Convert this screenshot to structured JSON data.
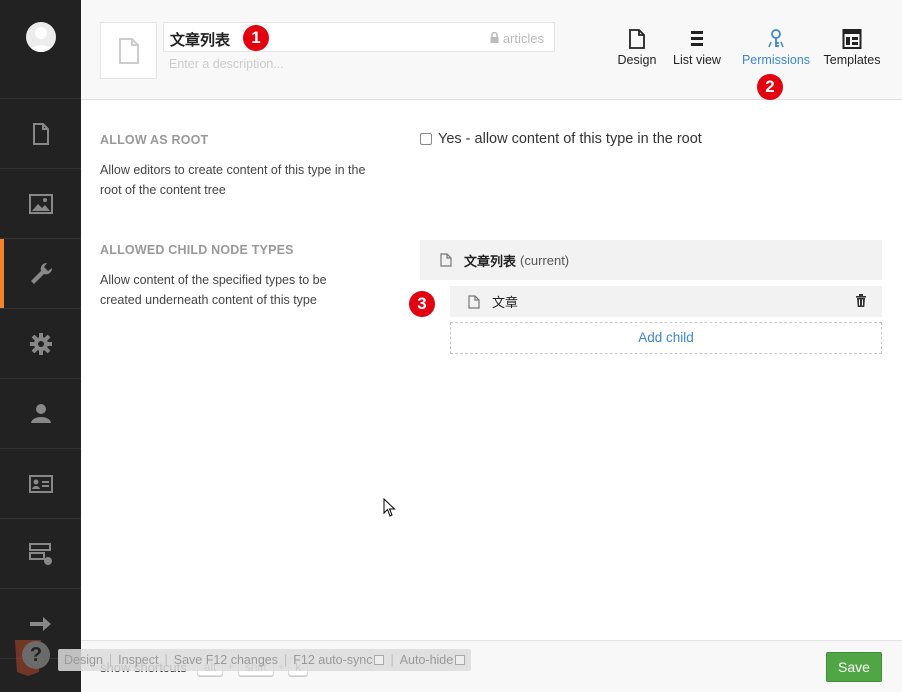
{
  "header": {
    "name_value": "文章列表",
    "alias": "articles",
    "description_placeholder": "Enter a description...",
    "tabs": [
      {
        "label": "Design",
        "icon": "document-icon"
      },
      {
        "label": "List view",
        "icon": "list-icon"
      },
      {
        "label": "Permissions",
        "icon": "key-icon",
        "active": true
      },
      {
        "label": "Templates",
        "icon": "template-icon"
      }
    ]
  },
  "badges": {
    "one": "1",
    "two": "2",
    "three": "3"
  },
  "sections": {
    "root": {
      "title": "ALLOW AS ROOT",
      "description": "Allow editors to create content of this type in the root of the content tree",
      "checkbox_label": "Yes - allow content of this type in the root"
    },
    "children": {
      "title": "ALLOWED CHILD NODE TYPES",
      "description": "Allow content of the specified types to be created underneath content of this type",
      "current_name": "文章列表",
      "current_suffix": "(current)",
      "child_name": "文章",
      "add_child_label": "Add child"
    }
  },
  "footer": {
    "show_shortcuts": "show shortcuts",
    "key_alt": "alt",
    "key_shift": "shift",
    "key_k": "k",
    "plus": "+",
    "save_label": "Save"
  },
  "dev_bar": {
    "design": "Design",
    "inspect": "Inspect",
    "save_changes": "Save F12 changes",
    "auto_sync": "F12 auto-sync",
    "auto_hide": "Auto-hide"
  },
  "help": {
    "symbol": "?"
  },
  "colors": {
    "sidebar_bg": "#222222",
    "accent_orange": "#f5832b",
    "link_blue": "#3b86d6",
    "save_green": "#50a644",
    "badge_red": "#e3000f"
  }
}
